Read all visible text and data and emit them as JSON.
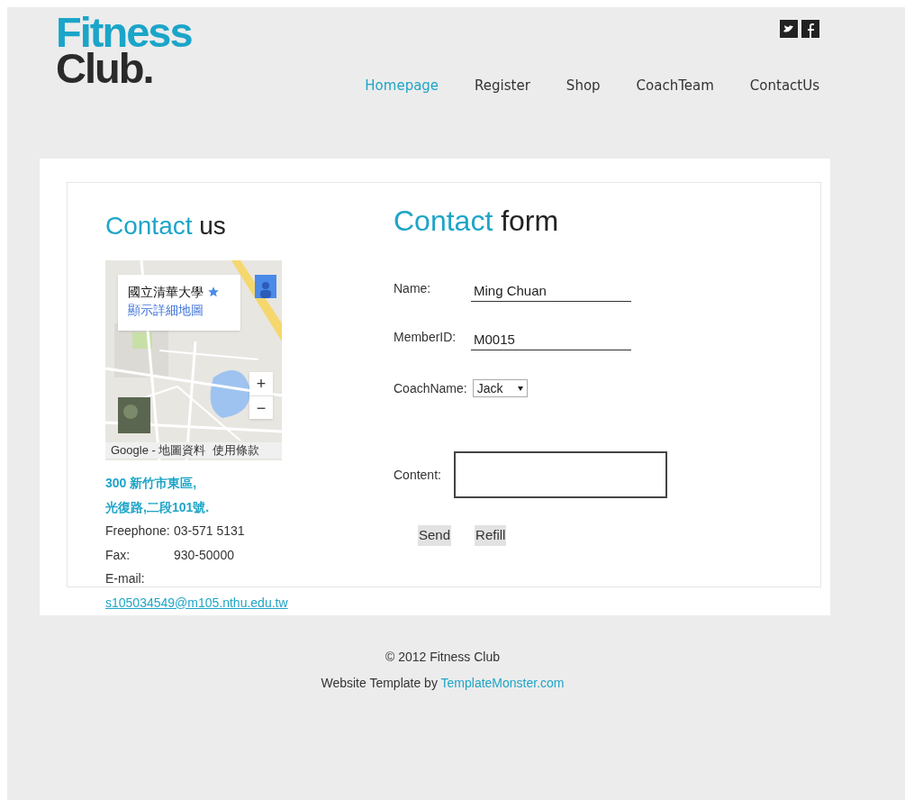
{
  "logo": {
    "line_1": "Fitness",
    "line_2": "Club."
  },
  "nav": [
    {
      "label": "Homepage",
      "selected": true
    },
    {
      "label": "Register",
      "selected": false
    },
    {
      "label": "Shop",
      "selected": false
    },
    {
      "label": "CoachTeam",
      "selected": false
    },
    {
      "label": "ContactUs",
      "selected": false
    }
  ],
  "contact": {
    "title_accent": "Contact",
    "title_rest": "us",
    "map": {
      "place_name": "國立清華大學",
      "details_link": "顯示詳細地圖",
      "zoom_in": "+",
      "zoom_out": "−",
      "attribution": "Google - 地圖資料",
      "terms": "使用條款"
    },
    "address": [
      "300 新竹市東區,",
      "光復路,二段101號."
    ],
    "lines": [
      {
        "label": "Freephone:",
        "value": "03-571 5131"
      },
      {
        "label": "Fax:",
        "value": "930-50000"
      },
      {
        "label": "E-mail:"
      }
    ],
    "email": "s105034549@m105.nthu.edu.tw"
  },
  "form": {
    "title_accent": "Contact",
    "title_rest": "form",
    "fields": [
      {
        "kind": "text",
        "label": "Name:",
        "value": "Ming Chuan"
      },
      {
        "kind": "text",
        "label": "MemberID:",
        "value": "M0015"
      },
      {
        "kind": "select",
        "label": "CoachName:",
        "value": "Jack"
      },
      {
        "kind": "textarea",
        "label": "Content:"
      }
    ],
    "buttons": [
      "Send",
      "Refill"
    ]
  },
  "footer": {
    "copyright": "© 2012 Fitness Club",
    "credit": "Website Template by",
    "credit_link": "TemplateMonster.com"
  }
}
